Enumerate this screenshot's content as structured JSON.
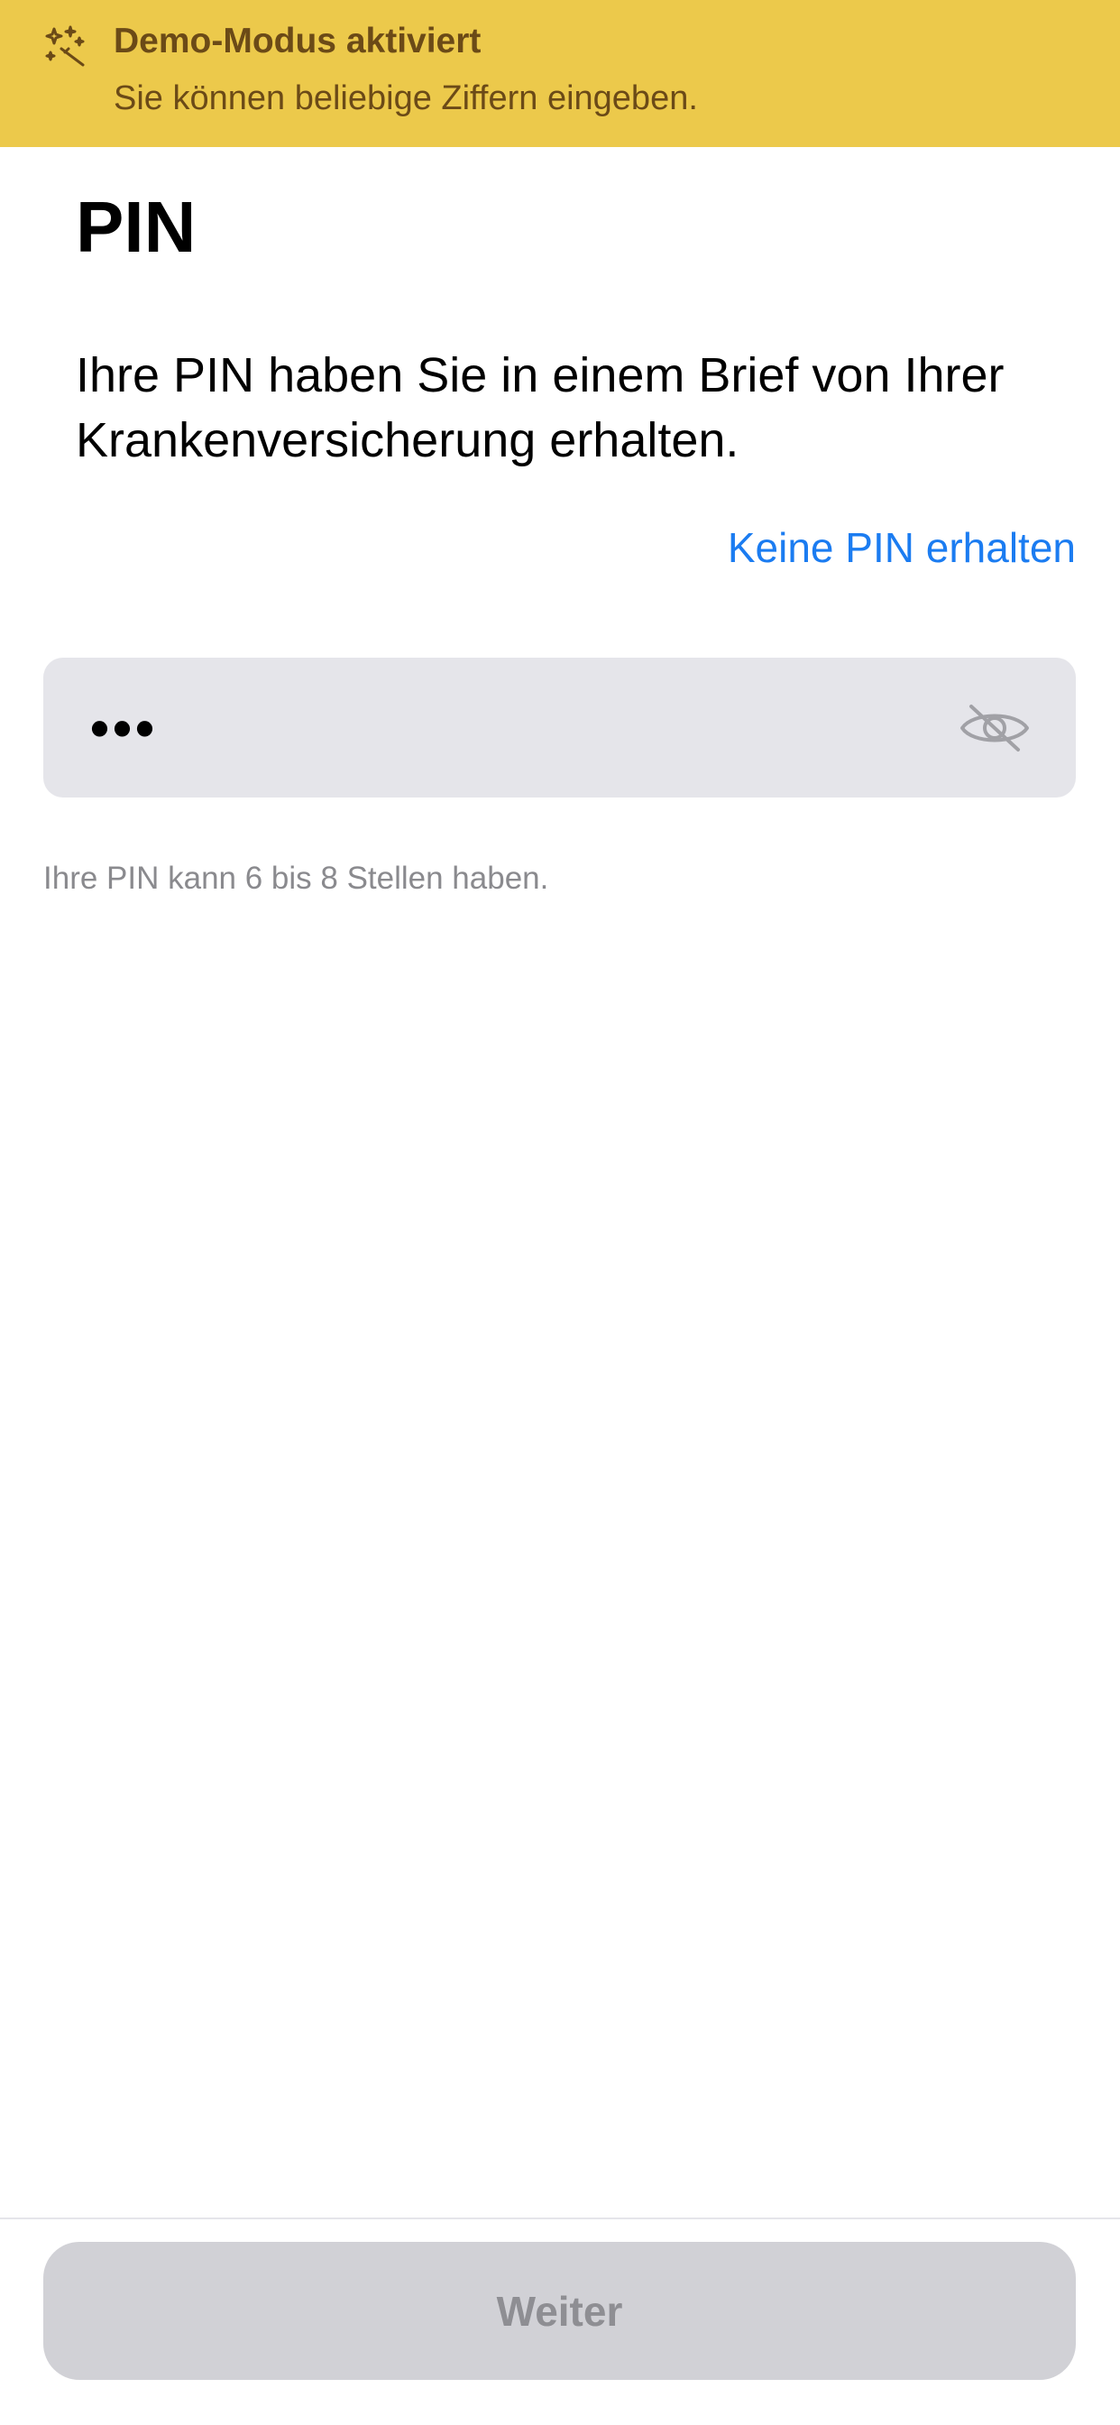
{
  "demo_banner": {
    "icon": "magic-sparkles-icon",
    "title": "Demo-Modus aktiviert",
    "subtitle": "Sie können beliebige Ziffern eingeben.",
    "background_color": "#ecc94b",
    "text_color": "#6b4a17"
  },
  "page": {
    "title": "PIN",
    "description": "Ihre PIN haben Sie in einem Brief von Ihrer Krankenversicherung erhalten.",
    "help_link": "Keine PIN erhalten"
  },
  "pin_input": {
    "value": "•••",
    "visibility_icon": "eye-slash-icon",
    "hint": "Ihre PIN kann 6 bis 8 Stellen haben."
  },
  "footer": {
    "continue_label": "Weiter",
    "continue_enabled": false
  },
  "colors": {
    "accent": "#1b7cf1",
    "field_background": "#e5e5ea",
    "disabled_button": "#d1d1d6"
  }
}
